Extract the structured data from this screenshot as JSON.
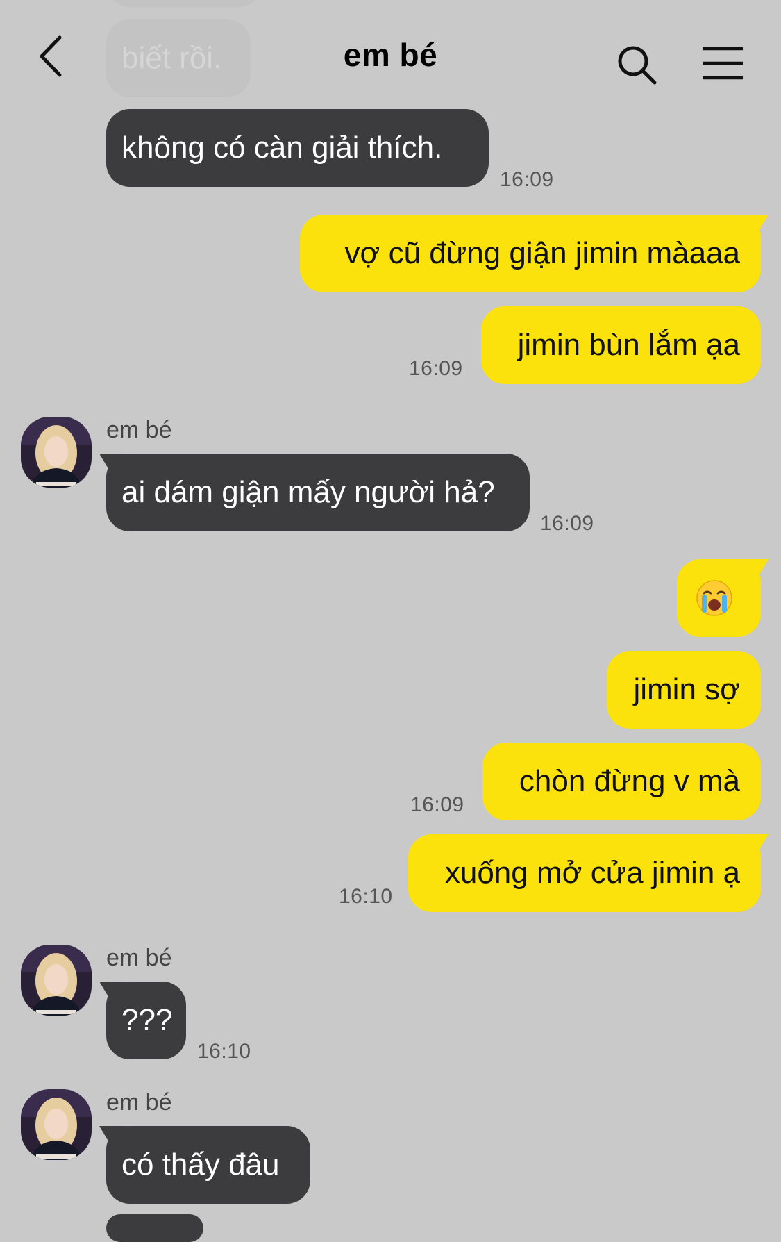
{
  "header": {
    "title": "em bé",
    "icons": [
      "back-icon",
      "search-icon",
      "menu-icon"
    ]
  },
  "colors": {
    "background": "#c9c9c9",
    "bubble_them": "#3c3c3e",
    "bubble_me": "#fbe20d"
  },
  "messages": [
    {
      "from": "them",
      "text": "biết rồi."
    },
    {
      "from": "them",
      "text": "không có càn giải thích.",
      "time": "16:09"
    },
    {
      "from": "me",
      "text": "vợ cũ đừng giận jimin màaaa"
    },
    {
      "from": "me",
      "text": "jimin bùn lắm ạa",
      "time": "16:09"
    },
    {
      "from": "them",
      "sender": "em bé",
      "text": "ai dám giận mấy người hả?",
      "time": "16:09"
    },
    {
      "from": "me",
      "text": "😭"
    },
    {
      "from": "me",
      "text": "jimin sợ"
    },
    {
      "from": "me",
      "text": "chòn đừng v mà",
      "time": "16:09"
    },
    {
      "from": "me",
      "text": "xuống mở cửa jimin ạ",
      "time": "16:10"
    },
    {
      "from": "them",
      "sender": "em bé",
      "text": "???",
      "time": "16:10"
    },
    {
      "from": "them",
      "sender": "em bé",
      "text": "có thấy đâu"
    }
  ]
}
